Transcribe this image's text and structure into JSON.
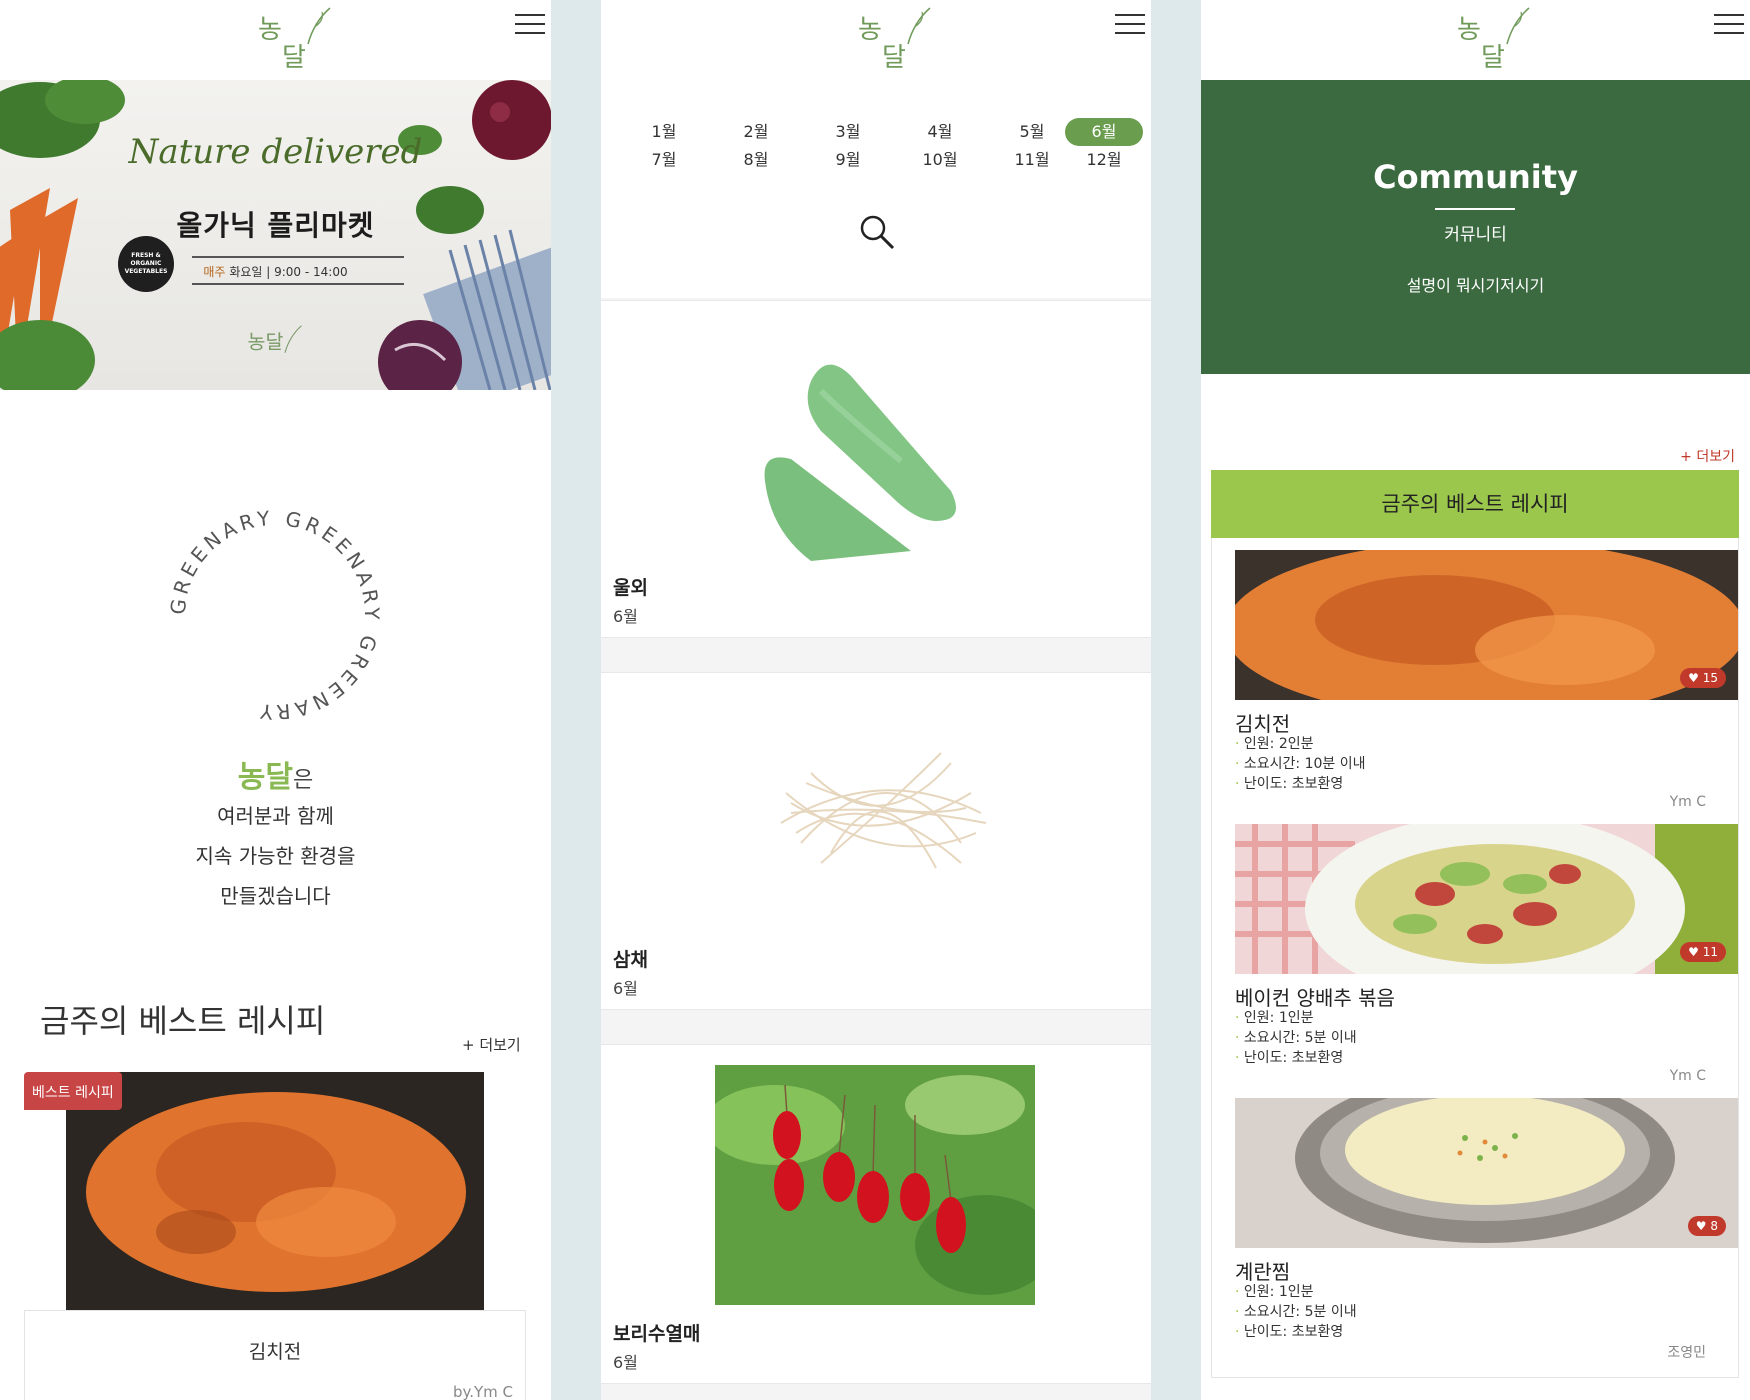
{
  "logo_text": "농달",
  "panel1": {
    "banner": {
      "script_title": "Nature delivered",
      "headline": "올가닉 플리마켓",
      "schedule_highlight": "매주",
      "schedule": "화요일 | 9:00 - 14:00",
      "badge": "FRESH & ORGANIC VEGETABLES"
    },
    "circle_text": "GREENARY GREENARY GREENARY ",
    "intro": {
      "brand": "농달",
      "brand_suffix": "은",
      "lines": [
        "여러분과 함께",
        "지속 가능한 환경을",
        "만들겠습니다"
      ]
    },
    "best": {
      "title": "금주의 베스트 레시피",
      "more": "+ 더보기",
      "tag": "베스트 레시피",
      "name": "김치전",
      "author": "by.Ym C"
    }
  },
  "panel2": {
    "months": [
      "1월",
      "2월",
      "3월",
      "4월",
      "5월",
      "6월",
      "7월",
      "8월",
      "9월",
      "10월",
      "11월",
      "12월"
    ],
    "active_month": "6월",
    "items": [
      {
        "name": "울외",
        "month": "6월"
      },
      {
        "name": "삼채",
        "month": "6월"
      },
      {
        "name": "보리수열매",
        "month": "6월"
      }
    ]
  },
  "panel3": {
    "title": "Community",
    "subtitle": "커뮤니티",
    "description": "설명이 뭐시기저시기",
    "more": "+ 더보기",
    "best_title": "금주의 베스트 레시피",
    "recipes": [
      {
        "name": "김치전",
        "likes": "15",
        "servings": "인원: 2인분",
        "time": "소요시간: 10분 이내",
        "level": "난이도: 초보환영",
        "author": "Ym C"
      },
      {
        "name": "베이컨 양배추 볶음",
        "likes": "11",
        "servings": "인원: 1인분",
        "time": "소요시간: 5분 이내",
        "level": "난이도: 초보환영",
        "author": "Ym C"
      },
      {
        "name": "계란찜",
        "likes": "8",
        "servings": "인원: 1인분",
        "time": "소요시간: 5분 이내",
        "level": "난이도: 초보환영",
        "author": "조영민"
      }
    ]
  },
  "colors": {
    "accent_green": "#8ab852",
    "community_green": "#3b6a40",
    "best_bar": "#9cc74d",
    "active_month": "#6a9e4e",
    "like_red": "#c0392b"
  }
}
